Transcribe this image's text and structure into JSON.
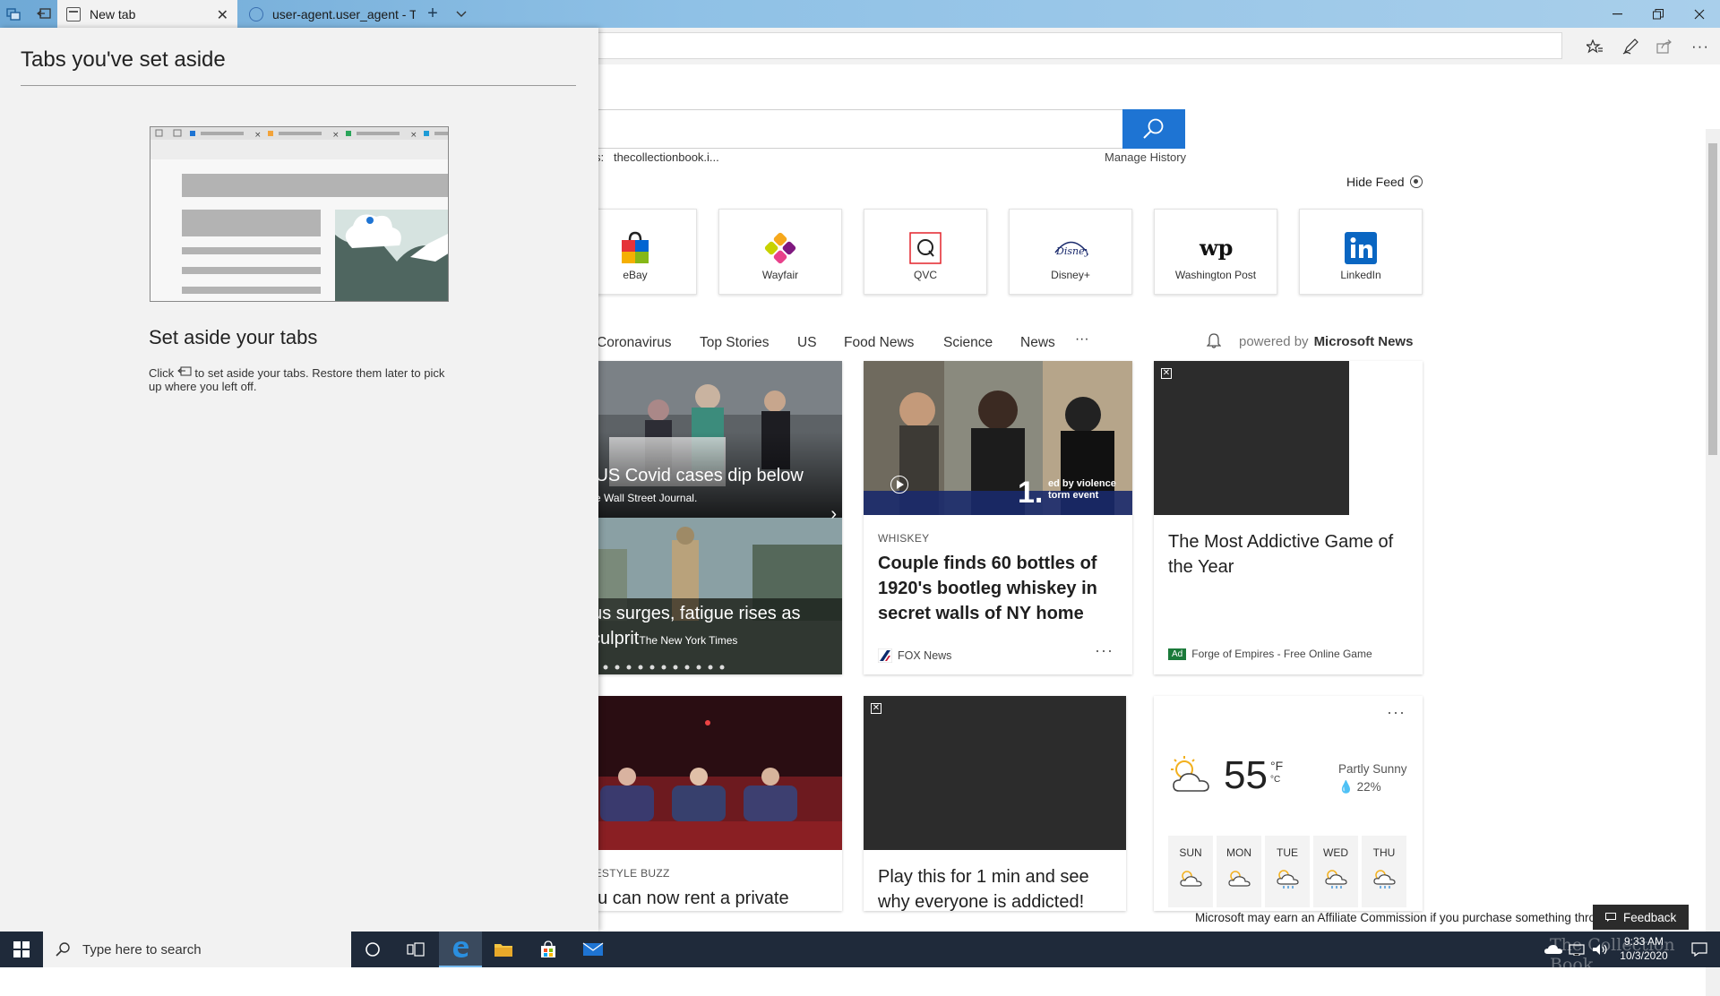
{
  "tabs": [
    {
      "label": "New tab",
      "active": true
    },
    {
      "label": "user-agent.user_agent - The"
    }
  ],
  "panel": {
    "title": "Tabs you've set aside",
    "heading": "Set aside your tabs",
    "desc_pre": "Click",
    "desc_post": "to set aside your tabs. Restore them later to pick up where you left off."
  },
  "search": {
    "recent_label": "s:",
    "recent_site": "thecollectionbook.i...",
    "manage_history": "Manage History"
  },
  "feed_toggle": "Hide Feed",
  "top_sites": [
    {
      "name": "eBay"
    },
    {
      "name": "Wayfair"
    },
    {
      "name": "QVC"
    },
    {
      "name": "Disney+"
    },
    {
      "name": "Washington Post"
    },
    {
      "name": "LinkedIn"
    }
  ],
  "feed_nav": [
    "Coronavirus",
    "Top Stories",
    "US",
    "Food News",
    "Science",
    "News",
    "···"
  ],
  "powered_by": {
    "prefix": "powered by",
    "brand": "Microsoft News"
  },
  "hero": {
    "story1_title": "ily US Covid cases dip below",
    "story1_source": "The Wall Street Journal.",
    "story2_title_line1": "virus surges, fatigue rises as",
    "story2_title_line2": "w culprit",
    "story2_source": "The New York Times"
  },
  "card_whiskey": {
    "category": "WHISKEY",
    "title": "Couple finds 60 bottles of 1920's bootleg whiskey in secret walls of NY home",
    "source": "FOX News",
    "video_overlay_num": "1.",
    "video_overlay_text": "ed by violence torm event"
  },
  "card_ad1": {
    "title": "The Most Addictive Game of the Year",
    "ad_badge": "Ad",
    "source": "Forge of Empires - Free Online Game"
  },
  "card_lifestyle": {
    "category": "FESTYLE BUZZ",
    "title": "ou can now rent a private"
  },
  "card_ad2": {
    "title": "Play this for 1 min and see why everyone is addicted!"
  },
  "weather": {
    "temp": "55",
    "unit_f": "°F",
    "unit_c": "°C",
    "condition": "Partly Sunny",
    "precip": "22%",
    "days": [
      "SUN",
      "MON",
      "TUE",
      "WED",
      "THU"
    ]
  },
  "affiliate_note": "Microsoft may earn an Affiliate Commission if you purchase something through",
  "feedback": "Feedback",
  "taskbar": {
    "search_placeholder": "Type here to search",
    "time": "9:33 AM",
    "date": "10/3/2020",
    "watermark": "The Collection Book"
  },
  "colors": {
    "accent": "#1e74d3",
    "taskbar": "#1f2a3a",
    "ad_badge": "#1b7a3a"
  }
}
